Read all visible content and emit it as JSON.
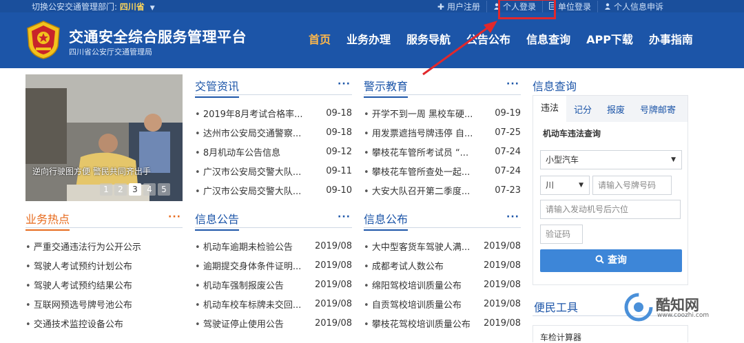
{
  "topbar": {
    "dept_label": "切换公安交通管理部门:",
    "dept_value": "四川省",
    "links": [
      {
        "icon": "plus-icon",
        "label": "用户注册"
      },
      {
        "icon": "person-icon",
        "label": "个人登录"
      },
      {
        "icon": "document-icon",
        "label": "单位登录"
      },
      {
        "icon": "person-icon",
        "label": "个人信息申诉"
      }
    ]
  },
  "header": {
    "title": "交通安全综合服务管理平台",
    "subtitle": "四川省公安厅交通管理局",
    "nav": [
      "首页",
      "业务办理",
      "服务导航",
      "公告公布",
      "信息查询",
      "APP下载",
      "办事指南"
    ]
  },
  "banner": {
    "caption": "逆向行驶图方便 警民共同齐出手",
    "pages": [
      "1",
      "2",
      "3",
      "4",
      "5"
    ],
    "current_page": "3"
  },
  "sections": {
    "jiaoguan": {
      "title": "交管资讯",
      "more": "···",
      "items": [
        {
          "text": "2019年8月考试合格率...",
          "date": "09-18"
        },
        {
          "text": "达州市公安局交通警察...",
          "date": "09-18"
        },
        {
          "text": "8月机动车公告信息",
          "date": "09-12"
        },
        {
          "text": "广汉市公安局交警大队...",
          "date": "09-11"
        },
        {
          "text": "广汉市公安局交警大队...",
          "date": "09-10"
        }
      ]
    },
    "jingshi": {
      "title": "警示教育",
      "more": "···",
      "items": [
        {
          "text": "开学不到一周 黑校车硬...",
          "date": "09-19"
        },
        {
          "text": "用发票遮挡号牌违停 自...",
          "date": "07-25"
        },
        {
          "text": "攀枝花车管所考试员 “...",
          "date": "07-24"
        },
        {
          "text": "攀枝花车管所查处一起...",
          "date": "07-24"
        },
        {
          "text": "大安大队召开第二季度...",
          "date": "07-23"
        }
      ]
    },
    "yewu": {
      "title": "业务热点",
      "more": "···",
      "items": [
        {
          "text": "严重交通违法行为公开公示"
        },
        {
          "text": "驾驶人考试预约计划公布"
        },
        {
          "text": "驾驶人考试预约结果公布"
        },
        {
          "text": "互联网预选号牌号池公布"
        },
        {
          "text": "交通技术监控设备公布"
        }
      ]
    },
    "xinxigonggao": {
      "title": "信息公告",
      "more": "···",
      "items": [
        {
          "text": "机动车逾期未检验公告",
          "date": "2019/08"
        },
        {
          "text": "逾期提交身体条件证明...",
          "date": "2019/08"
        },
        {
          "text": "机动车强制报废公告",
          "date": "2019/08"
        },
        {
          "text": "机动车校车标牌未交回...",
          "date": "2019/08"
        },
        {
          "text": "驾驶证停止使用公告",
          "date": "2019/08"
        }
      ]
    },
    "xinxigongbu": {
      "title": "信息公布",
      "more": "···",
      "items": [
        {
          "text": "大中型客货车驾驶人满...",
          "date": "2019/08"
        },
        {
          "text": "成都考试人数公布",
          "date": "2019/08"
        },
        {
          "text": "绵阳驾校培训质量公布",
          "date": "2019/08"
        },
        {
          "text": "自贡驾校培训质量公布",
          "date": "2019/08"
        },
        {
          "text": "攀枝花驾校培训质量公布",
          "date": "2019/08"
        }
      ]
    }
  },
  "query": {
    "title": "信息查询",
    "tabs": [
      "违法",
      "记分",
      "报废",
      "号牌邮寄"
    ],
    "subtitle": "机动车违法查询",
    "vehicle_type": "小型汽车",
    "province": "川",
    "plate_placeholder": "请输入号牌号码",
    "engine_placeholder": "请输入发动机号后六位",
    "captcha_placeholder": "验证码",
    "button": "查询"
  },
  "tools": {
    "title": "便民工具",
    "items": [
      "车检计算器"
    ]
  },
  "watermark": {
    "name": "酷知网",
    "url": "www.coozhi.com"
  },
  "colors": {
    "header_bg": "#1c55a8",
    "nav_active": "#ffb84a",
    "accent_orange": "#e76a1c",
    "button_blue": "#3d86d8",
    "highlight_red": "#e1282c"
  }
}
